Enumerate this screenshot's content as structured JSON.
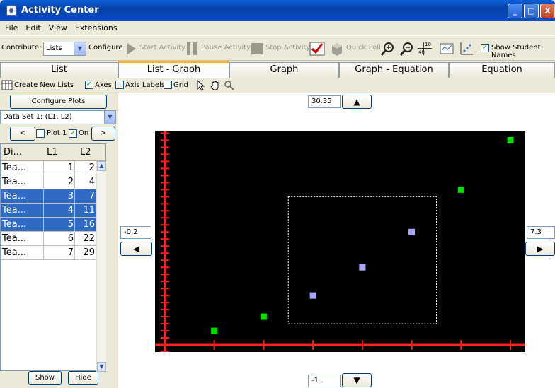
{
  "window": {
    "title": "Activity Center",
    "minimize": "_",
    "maximize": "□",
    "close": "X"
  },
  "menu": [
    "File",
    "Edit",
    "View",
    "Extensions"
  ],
  "toolbar": {
    "contribute_label": "Contribute:",
    "contribute_value": "Lists",
    "configure": "Configure",
    "start_activity": "Start Activity",
    "pause_activity": "Pause Activity",
    "stop_activity": "Stop Activity",
    "quick_poll": "Quick Poll",
    "zoom_fraction_top": "10",
    "zoom_fraction_bottom": "40",
    "show_student_names": "Show Student Names"
  },
  "tabs": [
    "List",
    "List - Graph",
    "Graph",
    "Graph - Equation",
    "Equation"
  ],
  "active_tab": "List - Graph",
  "subtools": {
    "create_new_lists": "Create New Lists",
    "axes": "Axes",
    "axis_labels": "Axis Labels",
    "grid": "Grid"
  },
  "left": {
    "configure_plots": "Configure Plots",
    "data_set": "Data Set 1: (L1, L2)",
    "prev": "<",
    "next": ">",
    "plot_label": "Plot 1",
    "on_label": "On",
    "columns": [
      "Di...",
      "L1",
      "L2"
    ],
    "rows": [
      {
        "name": "Tea...",
        "l1": "1",
        "l2": "2",
        "selected": false
      },
      {
        "name": "Tea...",
        "l1": "2",
        "l2": "4",
        "selected": false
      },
      {
        "name": "Tea...",
        "l1": "3",
        "l2": "7",
        "selected": true
      },
      {
        "name": "Tea...",
        "l1": "4",
        "l2": "11",
        "selected": true
      },
      {
        "name": "Tea...",
        "l1": "5",
        "l2": "16",
        "selected": true
      },
      {
        "name": "Tea...",
        "l1": "6",
        "l2": "22",
        "selected": false
      },
      {
        "name": "Tea...",
        "l1": "7",
        "l2": "29",
        "selected": false
      }
    ],
    "show": "Show",
    "hide": "Hide"
  },
  "graph": {
    "ymax": "30.35",
    "ymin": "-1",
    "xmin": "-0.2",
    "xmax": "7.3"
  },
  "chart_data": {
    "type": "scatter",
    "x": [
      1,
      2,
      3,
      4,
      5,
      6,
      7
    ],
    "y": [
      2,
      4,
      7,
      11,
      16,
      22,
      29
    ],
    "selected": [
      false,
      false,
      true,
      true,
      true,
      false,
      false
    ],
    "xlim": [
      -0.2,
      7.3
    ],
    "ylim": [
      -1,
      30.35
    ],
    "colors": {
      "point": "#00dd00",
      "selected_point": "#a6a6ff",
      "background": "#000000",
      "axis": "#ff2020"
    }
  }
}
